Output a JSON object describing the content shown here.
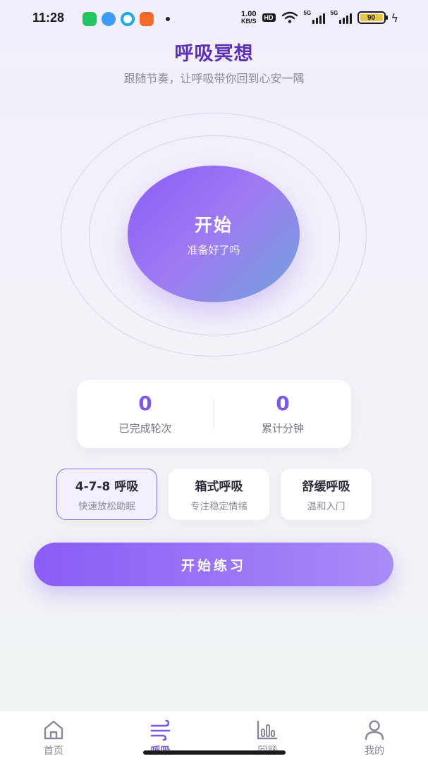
{
  "status_bar": {
    "time": "11:28",
    "net_speed_value": "1.00",
    "net_speed_unit": "KB/S",
    "hd_label": "HD",
    "signal_label_1": "5G",
    "signal_label_2": "5G",
    "battery": "90",
    "app_icons": [
      "green-app-icon",
      "blue-app-icon",
      "cyan-app-icon",
      "orange-app-icon"
    ]
  },
  "header": {
    "title": "呼吸冥想",
    "subtitle": "跟随节奏，让呼吸带你回到心安一隅"
  },
  "orb": {
    "label": "开始",
    "sub": "准备好了吗"
  },
  "stats": [
    {
      "value": "0",
      "label": "已完成轮次"
    },
    {
      "value": "0",
      "label": "累计分钟"
    }
  ],
  "modes": [
    {
      "title": "4-7-8 呼吸",
      "desc": "快速放松助眠",
      "selected": true
    },
    {
      "title": "箱式呼吸",
      "desc": "专注稳定情绪",
      "selected": false
    },
    {
      "title": "舒缓呼吸",
      "desc": "温和入门",
      "selected": false
    }
  ],
  "cta": {
    "label": "开始练习"
  },
  "nav": [
    {
      "label": "首页",
      "icon": "home-icon",
      "active": false
    },
    {
      "label": "呼吸",
      "icon": "wind-icon",
      "active": true
    },
    {
      "label": "回顾",
      "icon": "bar-chart-icon",
      "active": false
    },
    {
      "label": "我的",
      "icon": "user-icon",
      "active": false
    }
  ],
  "colors": {
    "accent": "#7e57e6",
    "title": "#5b2fb8",
    "battery": "#e9c549"
  }
}
